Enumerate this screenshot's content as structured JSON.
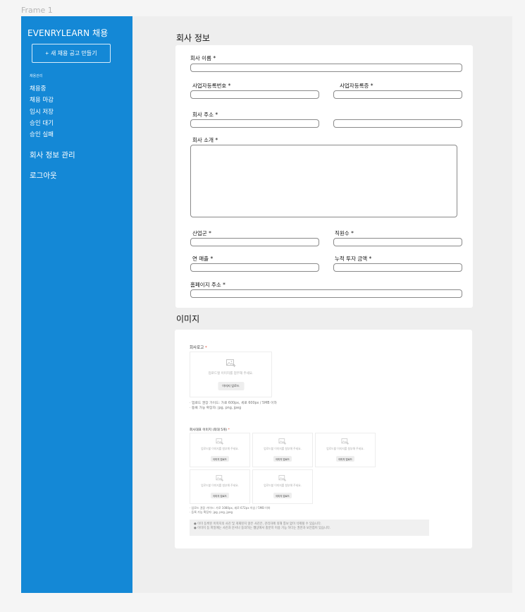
{
  "frame": {
    "label": "Frame 1"
  },
  "sidebar": {
    "brand": "EVENRYLEARN 채용",
    "new_post": {
      "icon": "plus",
      "label": "새 채용 공고 만들기"
    },
    "section_title": "채용관리",
    "nav": [
      "채용중",
      "채용 마감",
      "임시 저장",
      "승인 대기",
      "승인 실패"
    ],
    "company_info": "회사 정보 관리",
    "logout": "로그아웃"
  },
  "company": {
    "title": "회사 정보",
    "fields": {
      "name": "회사 이름 *",
      "biz_number": "사업자등록번호 *",
      "biz_cert": "사업자등록증 *",
      "address": "회사 주소 *",
      "intro": "회사 소개 *",
      "industry": "산업군 *",
      "employees": "직원수 *",
      "revenue": "연 매출 *",
      "investment": "누적 투자 금액 *",
      "homepage": "홈페이지 주소 *"
    }
  },
  "images": {
    "title": "이미지",
    "logo": {
      "label": "회사로고",
      "required_mark": "*",
      "drop_text": "업로드할 이미지를 첨부해 주세요.",
      "button": "이미지 업로드",
      "guide": [
        "· 업로드 권장 가이드: 가로 600px, 세로 600px / 5MB 이하",
        "· 등록 가능 확장자: jpg, png, jpeg"
      ]
    },
    "gallery": {
      "label": "회사대표 이미지 (최대 5개)",
      "required_mark": "*",
      "drop_text": "업로드할 이미지를 첨부해 주세요.",
      "button": "이미지 업로드",
      "guide": [
        "· 업로드 권장 가이드: 가로 1080px, 세로 672px 이상 / 5MB 이하",
        "· 등록 가능 확장자: jpg, png, jpeg"
      ]
    },
    "notice": [
      "● 이미 등록된 이미지의 사진 및 게재된지 않은 사진은, 관리자에 의해 통보 없이 삭제될 수 있습니다.",
      "● 이미지 등 파일에는 사진과 문서나 동의하는 웹상에서 충분히 이용 가능 하다는 권한과 보안점이 있습니다."
    ]
  }
}
